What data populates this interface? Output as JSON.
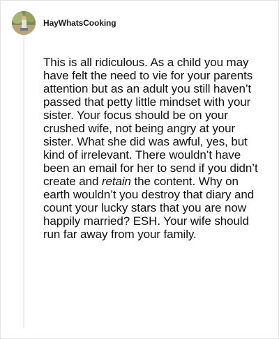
{
  "comment": {
    "username": "HayWhatsCooking",
    "avatar_icon": "user-avatar-photo",
    "body_part1": "This is all ridiculous. As a child you may have felt the need to vie for your parents attention but as an adult you still haven’t passed that petty little mindset with your sister. Your focus should be on your crushed wife, not being angry at your sister. What she did was awful, yes, but kind of irrelevant. There wouldn’t have been an email for her to send if you didn’t create and ",
    "body_emphasis": "retain",
    "body_part2": " the content. Why on earth wouldn’t you destroy that diary and count your lucky stars that you are now happily married? ESH. Your wife should run far away from your family."
  }
}
